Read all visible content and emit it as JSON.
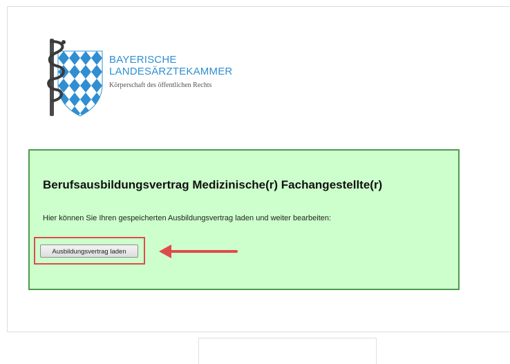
{
  "header": {
    "org_line1": "BAYERISCHE",
    "org_line2": "LANDESÄRZTEKAMMER",
    "org_subtitle": "Körperschaft des öffentlichen Rechts"
  },
  "panel": {
    "title": "Berufsausbildungsvertrag Medizinische(r) Fachangestellte(r)",
    "description": "Hier können Sie Ihren gespeicherten Ausbildungsvertrag laden und weiter bearbeiten:",
    "load_button_label": "Ausbildungsvertrag laden"
  },
  "colors": {
    "panel_background": "#ccffcc",
    "panel_border": "#4e9a4e",
    "highlight": "#e04a4a",
    "logo_blue": "#2f8fd1"
  },
  "icons": {
    "logo": "bavarian-shield-staff-of-asclepius-logo",
    "annotation": "red-arrow-annotation"
  }
}
